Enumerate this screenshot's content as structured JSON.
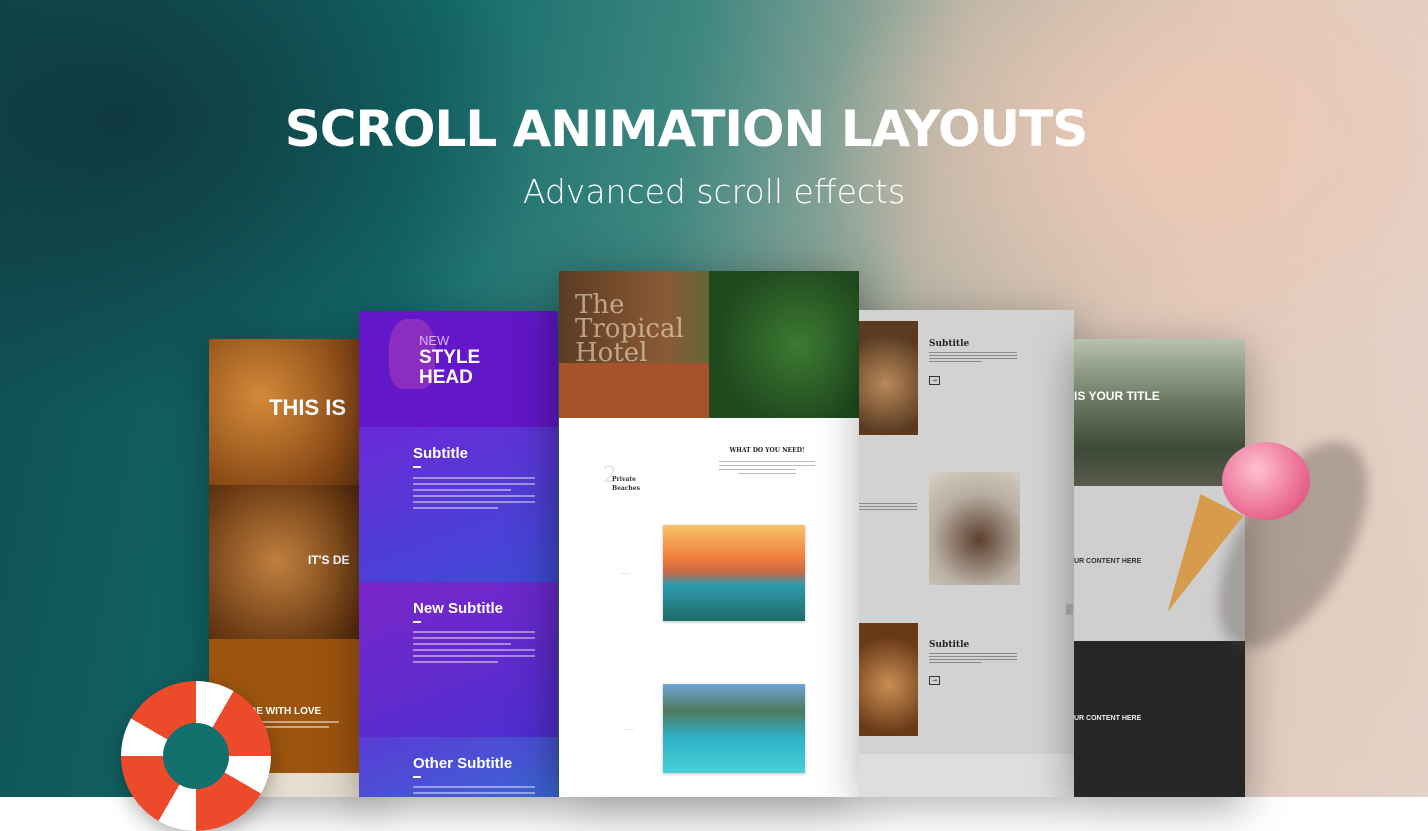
{
  "header": {
    "title": "SCROLL ANIMATION LAYOUTS",
    "subtitle": "Advanced scroll effects"
  },
  "panel_bakery": {
    "heading": "THIS IS",
    "section2": "IT'S DE",
    "section3": "DE WITH LOVE"
  },
  "panel_purple": {
    "badge": "NEW",
    "headline": "STYLE HEAD",
    "subtitle1": "Subtitle",
    "subtitle2": "New Subtitle",
    "subtitle3": "Other Subtitle"
  },
  "panel_hotel": {
    "hero_title": "The Tropical Hotel",
    "section_heading": "WHAT DO YOU NEED!",
    "feature": "Private Beaches",
    "feature_number": "2"
  },
  "panel_grey": {
    "subtitle1": "Subtitle",
    "subtitle2": "Subtitle",
    "arrow_icon": "arrow-right"
  },
  "panel_forest": {
    "title": "IS YOUR TITLE",
    "content1": "UR CONTENT HERE",
    "content2": "UR CONTENT HERE"
  }
}
